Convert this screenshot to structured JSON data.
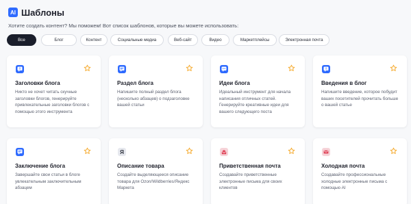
{
  "header": {
    "logo_text": "AI",
    "title": "Шаблоны",
    "subtitle": "Хотите создать контент? Мы поможем! Вот список шаблонов, которые вы можете использовать:"
  },
  "filters": [
    {
      "label": "Все",
      "active": true
    },
    {
      "label": "Блог",
      "active": false
    },
    {
      "label": "Контент",
      "active": false
    },
    {
      "label": "Социальные медиа",
      "active": false
    },
    {
      "label": "Веб-сайт",
      "active": false
    },
    {
      "label": "Видео",
      "active": false
    },
    {
      "label": "Маркетплейсы",
      "active": false
    },
    {
      "label": "Электронная почта",
      "active": false
    }
  ],
  "colors": {
    "accent": "#2f6bff",
    "star": "#f5a623",
    "active_chip": "#1a1e2b"
  },
  "cards": [
    {
      "icon": "chat-exclaim-icon",
      "title": "Заголовки блога",
      "description": "Никто не хочет читать скучные заголовки блогов, генерируйте привлекательные заголовки блогов с помощью этого инструмента"
    },
    {
      "icon": "chat-lines-icon",
      "title": "Раздел блога",
      "description": "Напишите полный раздел блога (несколько абзацев) о подзаголовке вашей статьи"
    },
    {
      "icon": "chat-dots-icon",
      "title": "Идеи блога",
      "description": "Идеальный инструмент для начала написания отличных статей. Генерируйте креативные идеи для вашего следующего поста"
    },
    {
      "icon": "chat-exclaim-icon",
      "title": "Введения в блог",
      "description": "Напишите введение, которое побудит ваших посетителей прочитать больше о вашей статье"
    },
    {
      "icon": "chat-lines-icon",
      "title": "Заключение блога",
      "description": "Завершайте свои статьи в блоге увлекательным заключительным абзацем"
    },
    {
      "icon": "yandex-market-icon",
      "icon_text": "Я",
      "title": "Описание товара",
      "description": "Создайте выделяющееся описание товара для Ozon/Wildberries/Яндекс Маркета"
    },
    {
      "icon": "mail-open-icon",
      "title": "Приветственная почта",
      "description": "Создавайте приветственные электронные письма для своих клиентов"
    },
    {
      "icon": "mail-closed-icon",
      "title": "Холодная почта",
      "description": "Создавайте профессиональные холодные электронные письма с помощью AI"
    }
  ]
}
